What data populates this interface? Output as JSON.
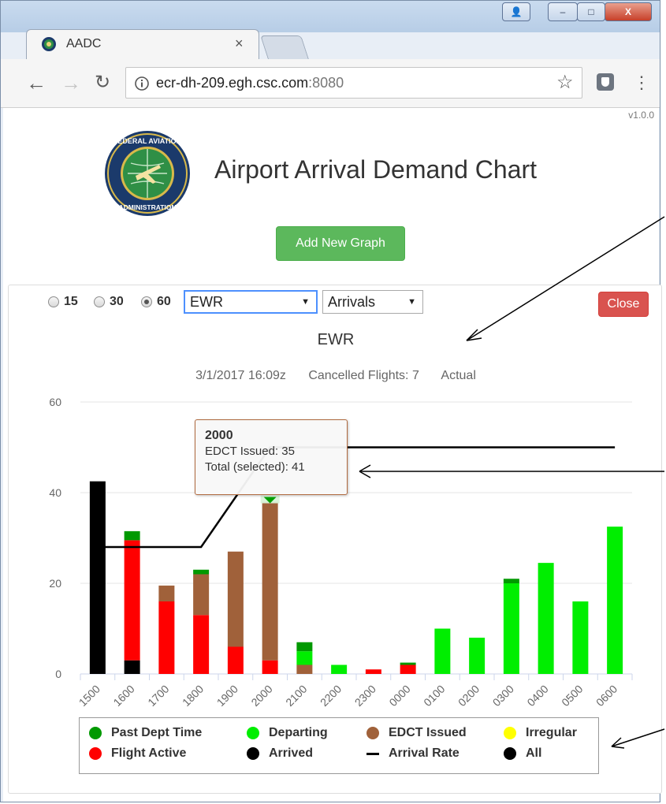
{
  "browser": {
    "tab_title": "AADC",
    "tab_close": "×",
    "url_host": "ecr-dh-209.egh.csc.com",
    "url_port": ":8080",
    "window_buttons": {
      "user": "👤",
      "minimize": "–",
      "maximize": "□",
      "close": "X"
    }
  },
  "page": {
    "version": "v1.0.0",
    "title": "Airport Arrival Demand Chart",
    "add_graph_label": "Add New Graph"
  },
  "panel": {
    "intervals": [
      {
        "label": "15",
        "checked": false
      },
      {
        "label": "30",
        "checked": false
      },
      {
        "label": "60",
        "checked": true
      }
    ],
    "airport_select": "EWR",
    "type_select": "Arrivals",
    "close_label": "Close"
  },
  "chart_data": {
    "type": "bar",
    "stacked": true,
    "title": "EWR",
    "subtitle": {
      "date": "3/1/2017 16:09z",
      "cancelled": "Cancelled Flights: 7",
      "mode": "Actual"
    },
    "categories": [
      "1500",
      "1600",
      "1700",
      "1800",
      "1900",
      "2000",
      "2100",
      "2200",
      "2300",
      "0000",
      "0100",
      "0200",
      "0300",
      "0400",
      "0500",
      "0600"
    ],
    "ylim": [
      0,
      60
    ],
    "yticks": [
      0,
      20,
      40,
      60
    ],
    "grid": true,
    "series": [
      {
        "name": "All",
        "color": "#000000",
        "values": [
          42.5,
          0,
          0,
          0,
          0,
          0,
          0,
          0,
          0,
          0,
          0,
          0,
          0,
          0,
          0,
          0
        ]
      },
      {
        "name": "Arrived",
        "color": "#000000",
        "values": [
          0,
          3,
          0,
          0,
          0,
          0,
          0,
          0,
          0,
          0,
          0,
          0,
          0,
          0,
          0,
          0
        ]
      },
      {
        "name": "Flight Active",
        "color": "#ff0000",
        "values": [
          0,
          26.5,
          16,
          13,
          6,
          3,
          0,
          0,
          1,
          2,
          0,
          0,
          0,
          0,
          0,
          0
        ]
      },
      {
        "name": "EDCT Issued",
        "color": "#a0613a",
        "values": [
          0,
          0,
          3.5,
          9,
          21,
          35,
          2,
          0,
          0,
          0,
          0,
          0,
          0,
          0,
          0,
          0
        ]
      },
      {
        "name": "Irregular",
        "color": "#ffff00",
        "values": [
          0,
          0,
          0,
          0,
          0,
          0,
          0,
          0,
          0,
          0,
          0,
          0,
          0,
          0,
          0,
          0
        ]
      },
      {
        "name": "Departing",
        "color": "#00ee00",
        "values": [
          0,
          0,
          0,
          0,
          0,
          0,
          3,
          2,
          0,
          0,
          10,
          8,
          20,
          24.5,
          16,
          32.5
        ]
      },
      {
        "name": "Past Dept Time",
        "color": "#009900",
        "values": [
          0,
          2,
          0,
          1,
          0,
          0,
          2,
          0,
          0,
          0.5,
          0,
          0,
          1,
          0,
          0,
          0
        ]
      }
    ],
    "arrival_rate": {
      "name": "Arrival Rate",
      "color": "#000000",
      "values": [
        28,
        28,
        28,
        28,
        null,
        50,
        50,
        50,
        50,
        50,
        50,
        50,
        50,
        50,
        50,
        50
      ]
    },
    "selected_category": "2000",
    "tooltip": {
      "title": "2000",
      "lines": [
        "EDCT Issued: 35",
        "Total (selected): 41"
      ]
    },
    "legend": {
      "placement": "bottom",
      "items": [
        {
          "label": "Past Dept Time",
          "color": "#009900",
          "kind": "dot"
        },
        {
          "label": "Departing",
          "color": "#00ee00",
          "kind": "dot"
        },
        {
          "label": "EDCT Issued",
          "color": "#a0613a",
          "kind": "dot"
        },
        {
          "label": "Irregular",
          "color": "#ffff00",
          "kind": "dot"
        },
        {
          "label": "Flight Active",
          "color": "#ff0000",
          "kind": "dot"
        },
        {
          "label": "Arrived",
          "color": "#000000",
          "kind": "dot"
        },
        {
          "label": "Arrival Rate",
          "color": "#000000",
          "kind": "line"
        },
        {
          "label": "All",
          "color": "#000000",
          "kind": "dot"
        }
      ]
    }
  }
}
